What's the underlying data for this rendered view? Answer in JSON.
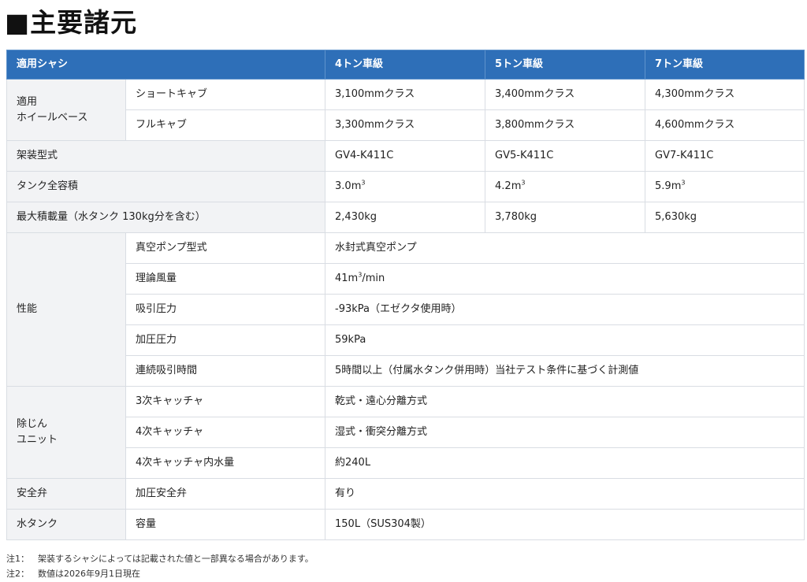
{
  "title": "■主要諸元",
  "table": {
    "header": {
      "col0": "適用シャシ",
      "col1": "4トン車級",
      "col2": "5トン車級",
      "col3": "7トン車級"
    },
    "wheelbase": {
      "category": "適用\nホイールベース",
      "short": {
        "label": "ショートキャブ",
        "v1": "3,100mmクラス",
        "v2": "3,400mmクラス",
        "v3": "4,300mmクラス"
      },
      "full": {
        "label": "フルキャブ",
        "v1": "3,300mmクラス",
        "v2": "3,800mmクラス",
        "v3": "4,600mmクラス"
      }
    },
    "model": {
      "category": "架装型式",
      "v1": "GV4-K411C",
      "v2": "GV5-K411C",
      "v3": "GV7-K411C"
    },
    "tank_volume": {
      "category": "タンク全容積",
      "v1": "3.0m",
      "v2": "4.2m",
      "v3": "5.9m",
      "unit_sup": "3"
    },
    "max_load": {
      "category": "最大積載量（水タンク 130kg分を含む）",
      "v1": "2,430kg",
      "v2": "3,780kg",
      "v3": "5,630kg"
    },
    "performance": {
      "category": "性能",
      "rows": [
        {
          "label": "真空ポンプ型式",
          "value": "水封式真空ポンプ"
        },
        {
          "label": "理論風量",
          "value_pre": "41m",
          "value_sup": "3",
          "value_post": "/min"
        },
        {
          "label": "吸引圧力",
          "value": "-93kPa（エゼクタ使用時）"
        },
        {
          "label": "加圧圧力",
          "value": "59kPa"
        },
        {
          "label": "連続吸引時間",
          "value": "5時間以上（付属水タンク併用時）当社テスト条件に基づく計測値"
        }
      ]
    },
    "dust_unit": {
      "category": "除じん\nユニット",
      "rows": [
        {
          "label": "3次キャッチャ",
          "value": "乾式・遠心分離方式"
        },
        {
          "label": "4次キャッチャ",
          "value": "湿式・衝突分離方式"
        },
        {
          "label": "4次キャッチャ内水量",
          "value": "約240L"
        }
      ]
    },
    "safety_valve": {
      "category": "安全弁",
      "label": "加圧安全弁",
      "value": "有り"
    },
    "water_tank": {
      "category": "水タンク",
      "label": "容量",
      "value": "150L（SUS304製）"
    }
  },
  "notes": [
    {
      "mark": "注1：",
      "text": "架装するシャシによっては記載された値と一部異なる場合があります。"
    },
    {
      "mark": "注2：",
      "text": "数値は2026年9月1日現在"
    }
  ]
}
